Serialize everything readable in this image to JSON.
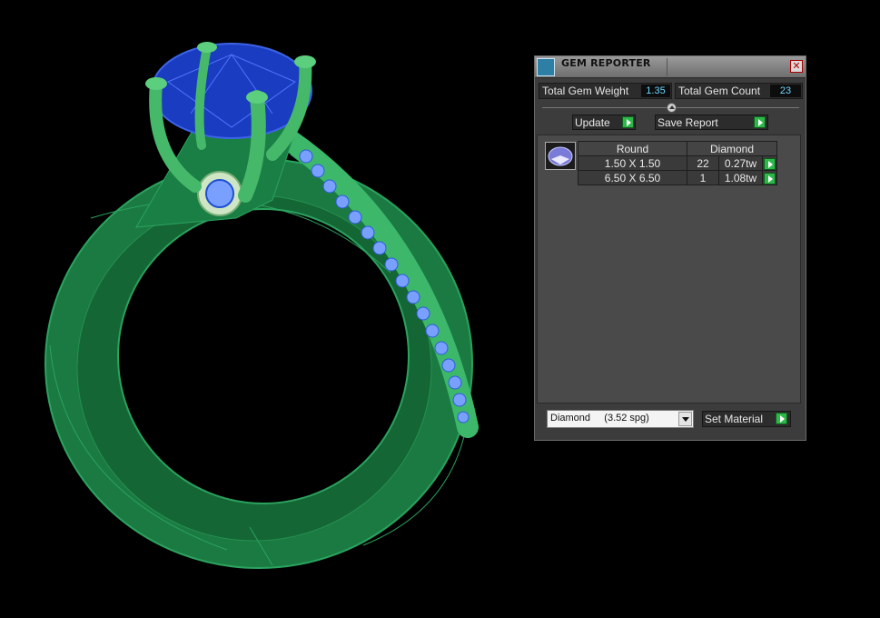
{
  "panel": {
    "title": "GEM REPORTER",
    "close_glyph": "✕",
    "icon": "gem-reporter-icon"
  },
  "stats": {
    "total_weight_label": "Total Gem Weight",
    "total_weight_value": "1.35",
    "total_count_label": "Total Gem Count",
    "total_count_value": "23"
  },
  "buttons": {
    "update": "Update",
    "save_report": "Save Report",
    "set_material": "Set Material"
  },
  "gem_table": {
    "headers": [
      "Round",
      "Diamond"
    ],
    "rows": [
      {
        "size": "1.50 X 1.50",
        "count": "22",
        "weight": "0.27tw"
      },
      {
        "size": "6.50 X 6.50",
        "count": "1",
        "weight": "1.08tw"
      }
    ]
  },
  "material": {
    "selected": "Diamond     (3.52 spg)"
  },
  "colors": {
    "ring_metal": "#1f8a4a",
    "gem_center": "#1a3cc0",
    "gem_side": "#7aa0ff",
    "accent_arrow": "#2fb84a",
    "value_text": "#6fd6ff"
  }
}
